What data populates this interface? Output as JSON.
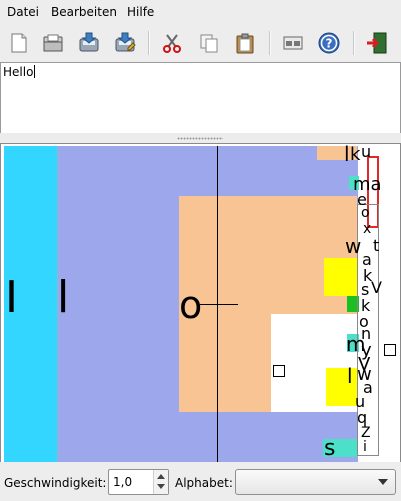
{
  "menubar": {
    "items": [
      {
        "label": "Datei",
        "underline": "D"
      },
      {
        "label": "Bearbeiten",
        "underline": "B"
      },
      {
        "label": "Hilfe",
        "underline": "H"
      }
    ]
  },
  "toolbar": {
    "buttons": [
      {
        "name": "new-icon"
      },
      {
        "name": "open-icon"
      },
      {
        "name": "save-icon"
      },
      {
        "name": "save-as-icon"
      },
      {
        "name": "cut-icon"
      },
      {
        "name": "copy-icon"
      },
      {
        "name": "paste-icon"
      },
      {
        "name": "view-icon"
      },
      {
        "name": "help-icon"
      },
      {
        "name": "quit-icon"
      }
    ]
  },
  "editor": {
    "text": "Hello"
  },
  "dasher": {
    "colors": {
      "cyan": "#33d6ff",
      "lavender": "#9da8ec",
      "peach": "#f8c493",
      "yellow": "#ffff00",
      "green": "#1bbf22",
      "teal": "#4de0c8",
      "red": "#e02a2a"
    },
    "big_glyphs": [
      "I",
      "l",
      "o"
    ],
    "small_glyphs": [
      "l",
      "k",
      "u",
      "ma",
      "e",
      "o",
      "x",
      "w",
      "t",
      "a",
      "k",
      "s",
      "V",
      "k",
      "o",
      "n",
      "m",
      "y",
      "V",
      "w",
      "a",
      "u",
      "q",
      "l",
      "Z",
      "s",
      "i"
    ]
  },
  "status": {
    "speed_label": "Geschwindigkeit:",
    "speed_value": "1,0",
    "alphabet_label": "Alphabet:",
    "alphabet_value": ""
  }
}
